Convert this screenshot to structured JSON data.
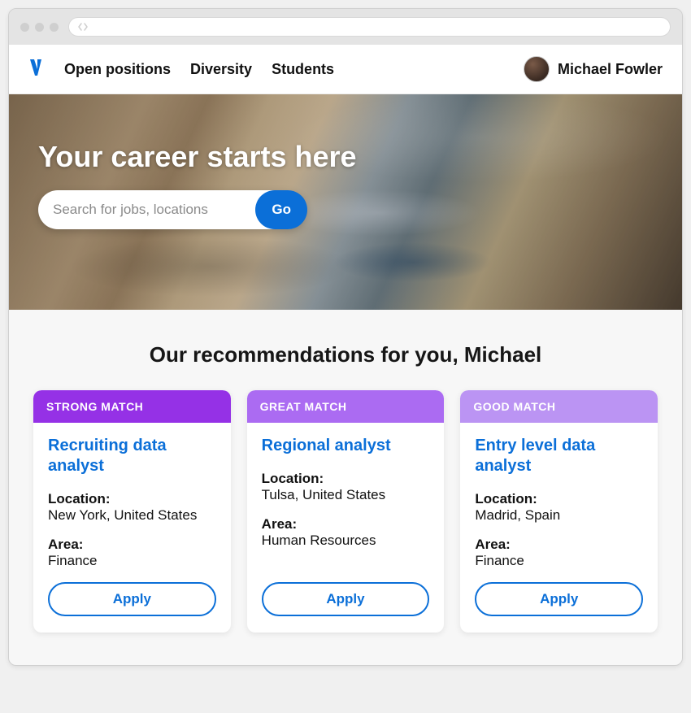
{
  "nav": {
    "items": [
      {
        "label": "Open positions"
      },
      {
        "label": "Diversity"
      },
      {
        "label": "Students"
      }
    ]
  },
  "user": {
    "name": "Michael Fowler"
  },
  "hero": {
    "headline": "Your career starts here",
    "search_placeholder": "Search for jobs, locations",
    "go_label": "Go"
  },
  "recommendations": {
    "heading": "Our recommendations for you, Michael",
    "location_label": "Location:",
    "area_label": "Area:",
    "apply_label": "Apply",
    "cards": [
      {
        "badge": "STRONG MATCH",
        "title": "Recruiting data analyst",
        "location": "New York, United States",
        "area": "Finance"
      },
      {
        "badge": "GREAT MATCH",
        "title": "Regional analyst",
        "location": "Tulsa, United States",
        "area": "Human Resources"
      },
      {
        "badge": "GOOD MATCH",
        "title": "Entry level data analyst",
        "location": "Madrid, Spain",
        "area": "Finance"
      }
    ]
  },
  "colors": {
    "primary_blue": "#0b6fd8",
    "match_strong": "#9531e6",
    "match_great": "#ab6bf2",
    "match_good": "#bb94f3"
  }
}
